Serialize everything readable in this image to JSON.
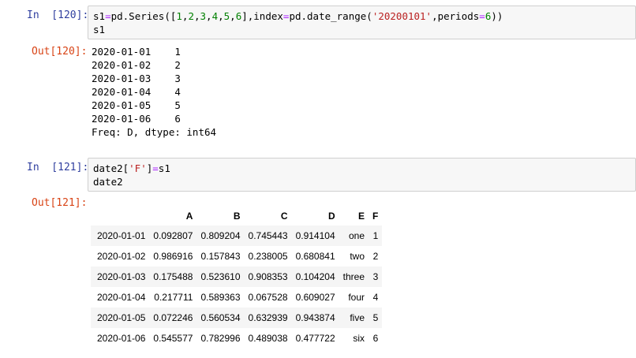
{
  "cells": [
    {
      "in_prompt": "In  [120]:",
      "out_prompt": "Out[120]:",
      "code": [
        "s1=pd.Series([1,2,3,4,5,6],index=pd.date_range('20200101',periods=6))",
        "s1"
      ],
      "output_lines": [
        "2020-01-01    1",
        "2020-01-02    2",
        "2020-01-03    3",
        "2020-01-04    4",
        "2020-01-05    5",
        "2020-01-06    6",
        "Freq: D, dtype: int64"
      ]
    },
    {
      "in_prompt": "In  [121]:",
      "out_prompt": "Out[121]:",
      "code": [
        "date2['F']=s1",
        "date2"
      ],
      "table": {
        "columns": [
          "",
          "A",
          "B",
          "C",
          "D",
          "E",
          "F"
        ],
        "rows": [
          [
            "2020-01-01",
            "0.092807",
            "0.809204",
            "0.745443",
            "0.914104",
            "one",
            "1"
          ],
          [
            "2020-01-02",
            "0.986916",
            "0.157843",
            "0.238005",
            "0.680841",
            "two",
            "2"
          ],
          [
            "2020-01-03",
            "0.175488",
            "0.523610",
            "0.908353",
            "0.104204",
            "three",
            "3"
          ],
          [
            "2020-01-04",
            "0.217711",
            "0.589363",
            "0.067528",
            "0.609027",
            "four",
            "4"
          ],
          [
            "2020-01-05",
            "0.072246",
            "0.560534",
            "0.632939",
            "0.943874",
            "five",
            "5"
          ],
          [
            "2020-01-06",
            "0.545577",
            "0.782996",
            "0.489038",
            "0.477722",
            "six",
            "6"
          ]
        ]
      }
    }
  ]
}
